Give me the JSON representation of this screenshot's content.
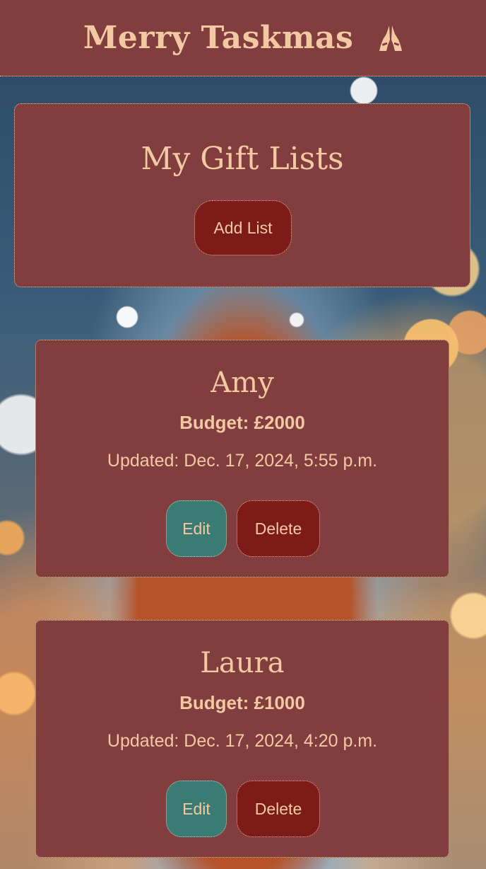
{
  "header": {
    "brand": "Merry Taskmas",
    "icon": "praying-hands-icon"
  },
  "hero": {
    "title": "My Gift Lists",
    "add_button": "Add List"
  },
  "lists": [
    {
      "name": "Amy",
      "budget": "Budget: £2000",
      "updated": "Updated: Dec. 17, 2024, 5:55 p.m.",
      "edit_label": "Edit",
      "delete_label": "Delete"
    },
    {
      "name": "Laura",
      "budget": "Budget: £1000",
      "updated": "Updated: Dec. 17, 2024, 4:20 p.m.",
      "edit_label": "Edit",
      "delete_label": "Delete"
    }
  ],
  "colors": {
    "panel": "#823d3e",
    "text": "#f3c9a3",
    "button_primary": "#7c1b18",
    "button_edit": "#3a7b74"
  }
}
